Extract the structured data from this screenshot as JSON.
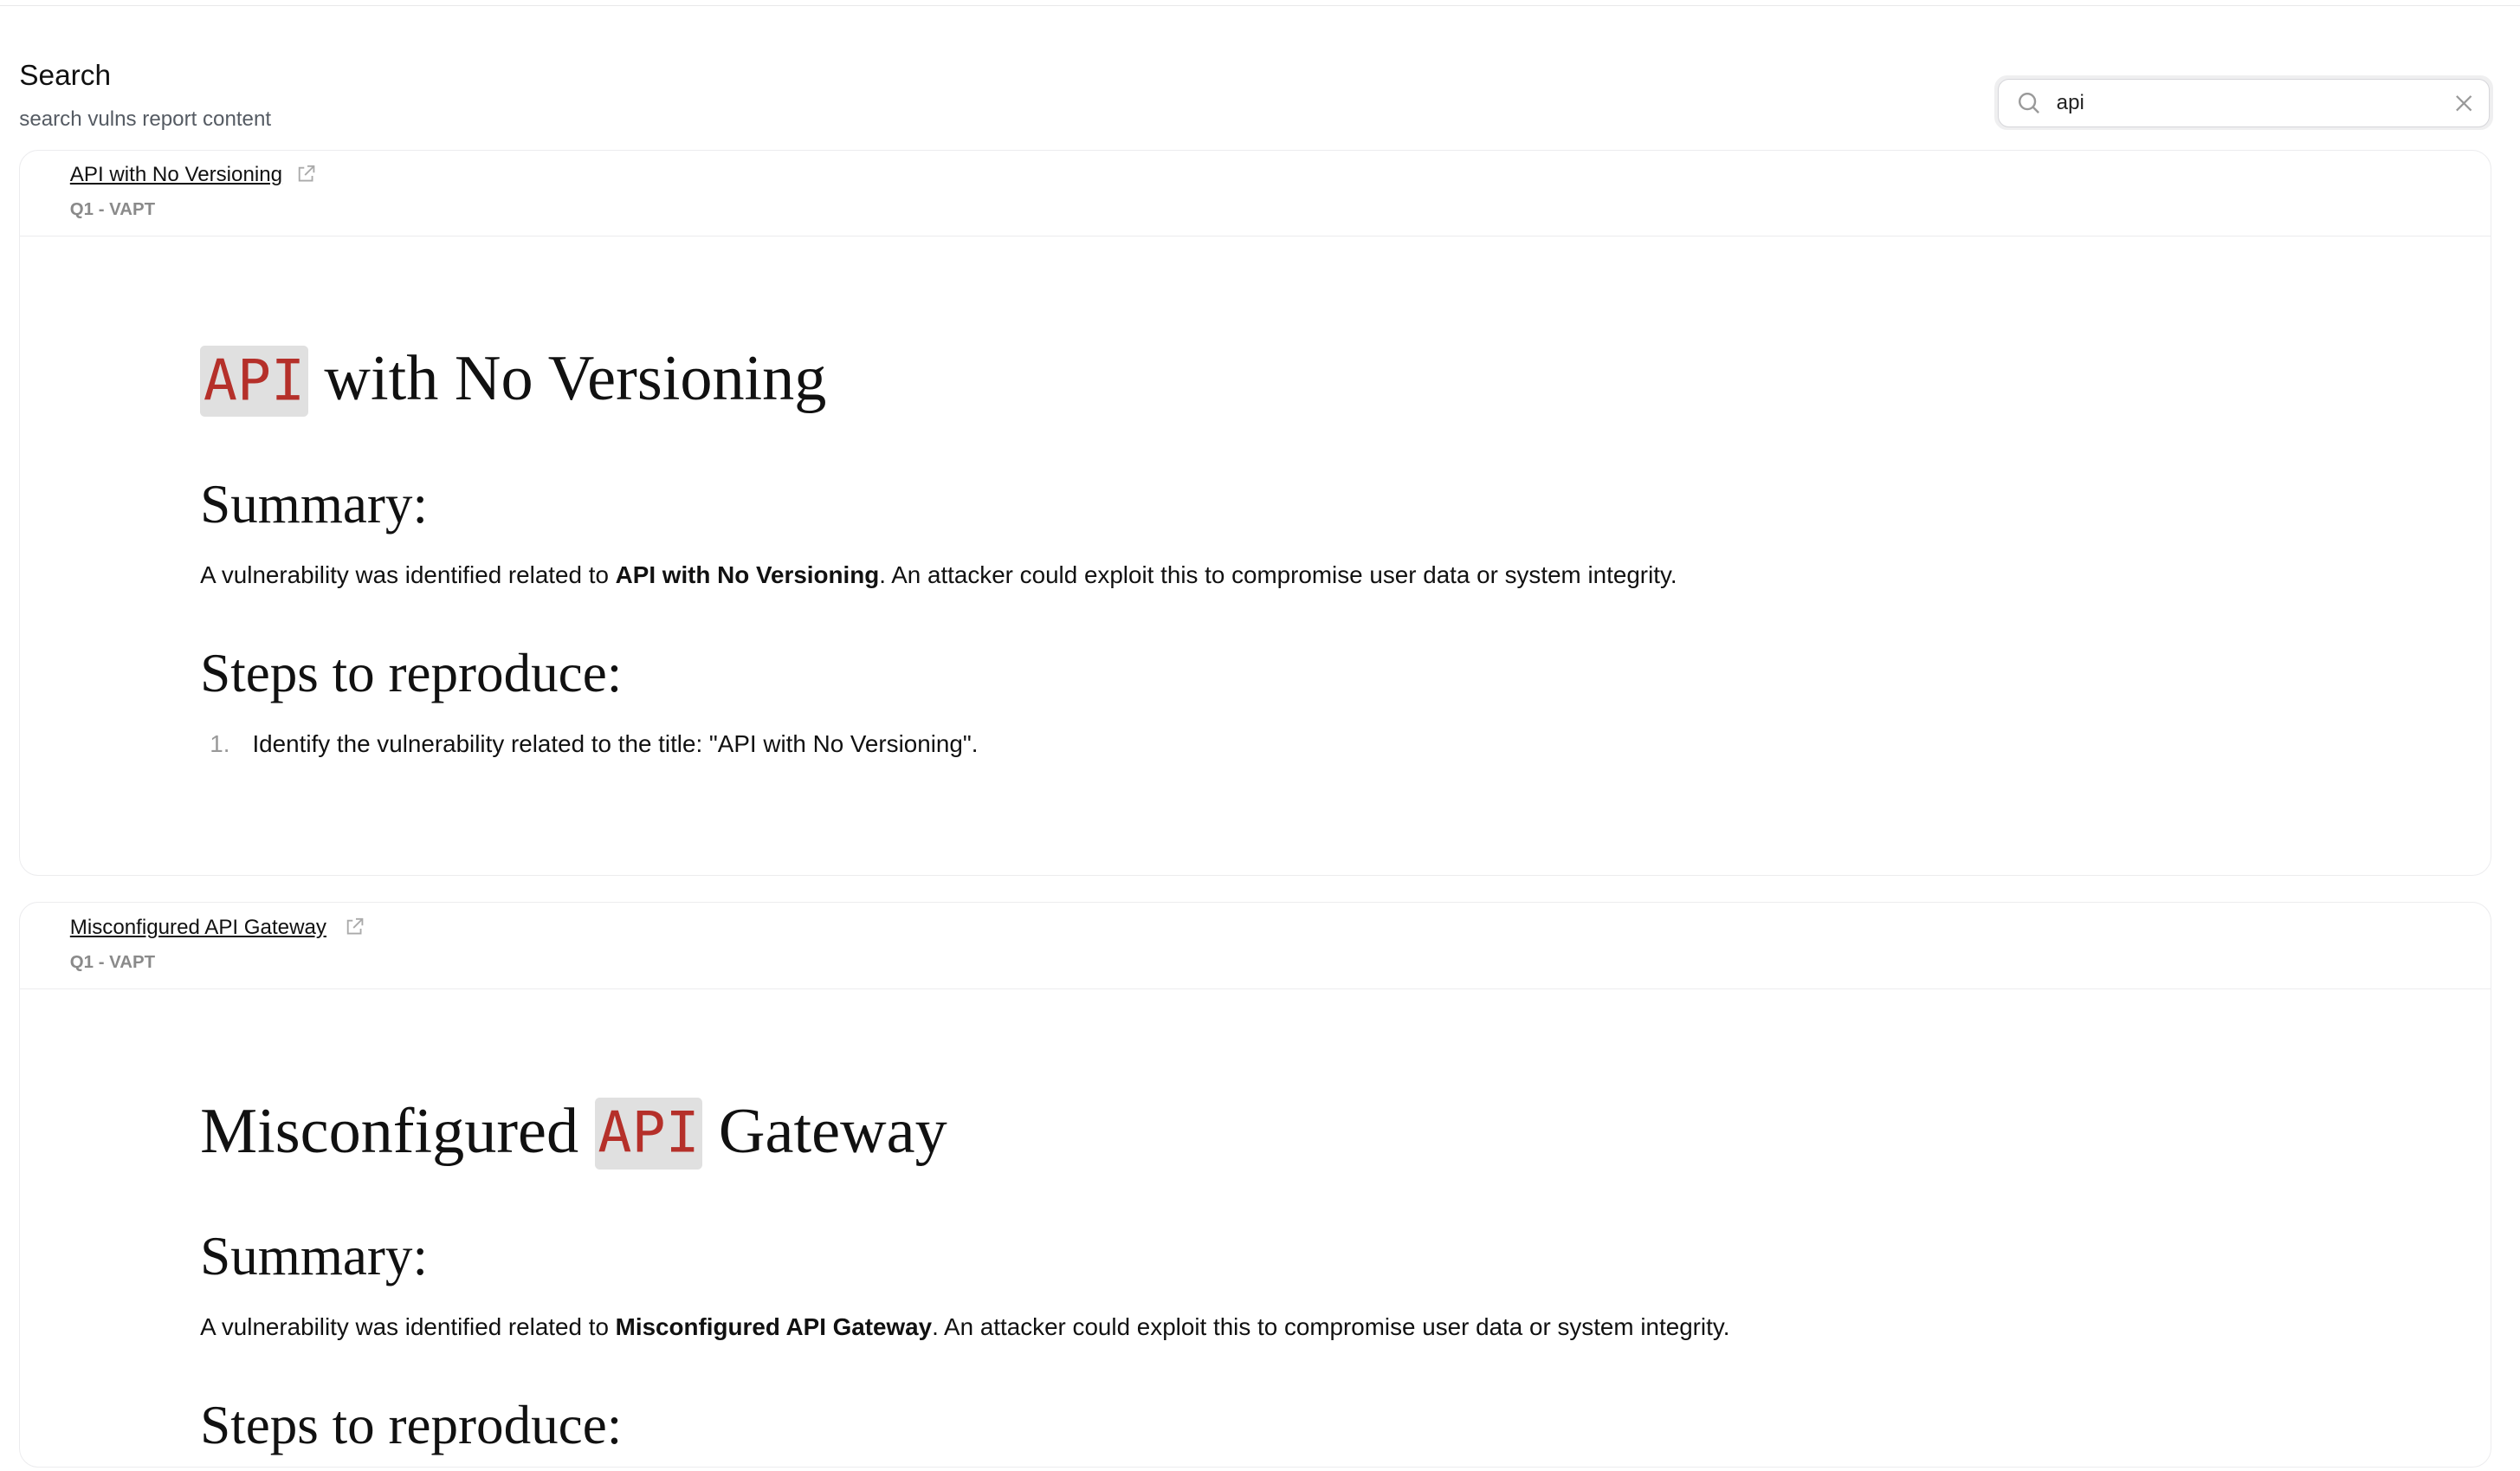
{
  "page": {
    "title": "Search",
    "subtitle": "search vulns report content"
  },
  "search": {
    "value": "api",
    "icon": "search-icon",
    "clear_icon": "close-icon"
  },
  "highlight_color": "#b5302a",
  "results": [
    {
      "title": "API with No Versioning",
      "meta": "Q1 - VAPT",
      "heading_match": "API",
      "heading_rest": " with No Versioning",
      "summary_heading": "Summary:",
      "summary_pre": "A vulnerability was identified related to ",
      "summary_bold": "API with No Versioning",
      "summary_post": ". An attacker could exploit this to compromise user data or system integrity.",
      "steps_heading": "Steps to reproduce:",
      "steps": [
        {
          "num": "1.",
          "text": "Identify the vulnerability related to the title: \"API with No Versioning\"."
        }
      ]
    },
    {
      "title": "Misconfigured API Gateway",
      "meta": "Q1 - VAPT",
      "heading_pre": "Misconfigured ",
      "heading_match": "API",
      "heading_rest": " Gateway",
      "summary_heading": "Summary:",
      "summary_pre": "A vulnerability was identified related to ",
      "summary_bold": "Misconfigured API Gateway",
      "summary_post": ". An attacker could exploit this to compromise user data or system integrity.",
      "steps_heading": "Steps to reproduce:"
    }
  ]
}
